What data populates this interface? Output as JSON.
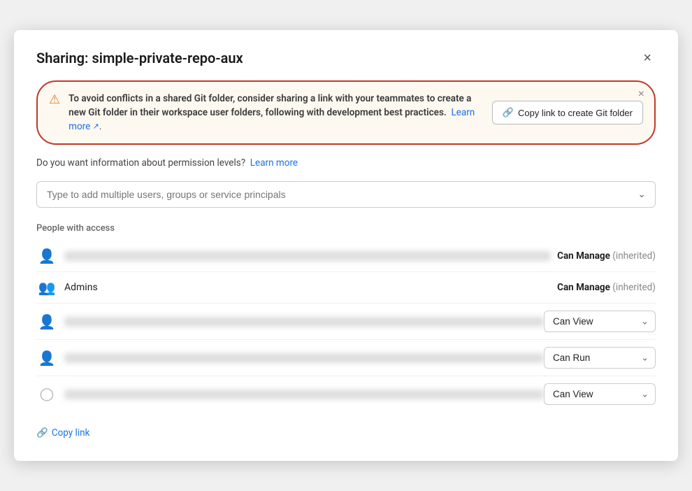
{
  "modal": {
    "title": "Sharing: simple-private-repo-aux",
    "close_label": "×"
  },
  "warning": {
    "icon": "⚠",
    "text_bold": "To avoid conflicts in a shared Git folder, consider sharing a link with your teammates to create a new Git folder in their workspace user folders, following with development best practices.",
    "learn_more_label": "Learn more",
    "dismiss_label": "×",
    "copy_git_btn_icon": "🔗",
    "copy_git_btn_label": "Copy link to create Git folder"
  },
  "permission_info": {
    "text": "Do you want information about permission levels?",
    "learn_more_label": "Learn more"
  },
  "search": {
    "placeholder": "Type to add multiple users, groups or service principals"
  },
  "people_section": {
    "label": "People with access",
    "people": [
      {
        "id": "person-1",
        "name": "",
        "blurred": true,
        "icon": "person",
        "permission": "Can Manage",
        "permission_note": "(inherited)",
        "has_dropdown": false
      },
      {
        "id": "person-2",
        "name": "Admins",
        "blurred": false,
        "icon": "group",
        "permission": "Can Manage",
        "permission_note": "(inherited)",
        "has_dropdown": false
      },
      {
        "id": "person-3",
        "name": "",
        "blurred": true,
        "icon": "person",
        "permission": "Can View",
        "permission_note": "",
        "has_dropdown": true
      },
      {
        "id": "person-4",
        "name": "",
        "blurred": true,
        "icon": "person",
        "permission": "Can Run",
        "permission_note": "",
        "has_dropdown": true
      },
      {
        "id": "person-5",
        "name": "",
        "blurred": true,
        "icon": "person-outline",
        "permission": "Can View",
        "permission_note": "",
        "has_dropdown": true
      }
    ]
  },
  "footer": {
    "copy_link_icon": "🔗",
    "copy_link_label": "Copy link"
  },
  "colors": {
    "accent": "#1a73e8",
    "warning_border": "#c0392b",
    "warning_bg": "#fdf8f0"
  }
}
